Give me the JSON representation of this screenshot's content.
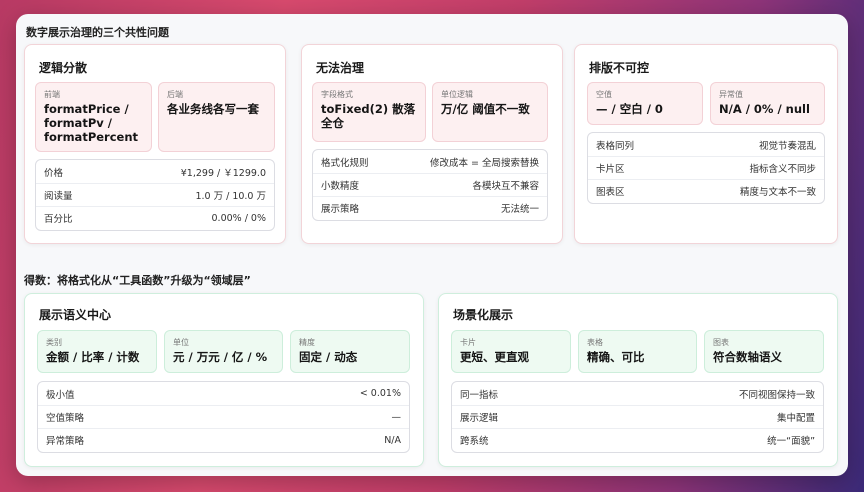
{
  "header": {
    "title": "数字展示治理的三个共性问题"
  },
  "problems": [
    {
      "title": "逻辑分散",
      "chips": [
        {
          "label": "前端",
          "value": "formatPrice / formatPv / formatPercent"
        },
        {
          "label": "后端",
          "value": "各业务线各写一套"
        }
      ],
      "rows": [
        {
          "k": "价格",
          "v": "¥1,299 / ￥1299.0"
        },
        {
          "k": "阅读量",
          "v": "1.0 万 / 10.0 万"
        },
        {
          "k": "百分比",
          "v": "0.00% / 0%"
        }
      ]
    },
    {
      "title": "无法治理",
      "chips": [
        {
          "label": "字段格式",
          "value": "toFixed(2) 散落全仓"
        },
        {
          "label": "单位逻辑",
          "value": "万/亿 阈值不一致"
        }
      ],
      "rows": [
        {
          "k": "格式化规则",
          "v": "修改成本 = 全局搜索替换"
        },
        {
          "k": "小数精度",
          "v": "各模块互不兼容"
        },
        {
          "k": "展示策略",
          "v": "无法统一"
        }
      ]
    },
    {
      "title": "排版不可控",
      "chips": [
        {
          "label": "空值",
          "value": "— / 空白 / 0"
        },
        {
          "label": "异常值",
          "value": "N/A / 0% / null"
        }
      ],
      "rows": [
        {
          "k": "表格同列",
          "v": "视觉节奏混乱"
        },
        {
          "k": "卡片区",
          "v": "指标含义不同步"
        },
        {
          "k": "图表区",
          "v": "精度与文本不一致"
        }
      ]
    }
  ],
  "section2": {
    "title": "得数：将格式化从“工具函数”升级为“领域层”"
  },
  "solutions": [
    {
      "title": "展示语义中心",
      "chips": [
        {
          "label": "类别",
          "value": "金额 / 比率 / 计数"
        },
        {
          "label": "单位",
          "value": "元 / 万元 / 亿 / %"
        },
        {
          "label": "精度",
          "value": "固定 / 动态"
        }
      ],
      "rows": [
        {
          "k": "极小值",
          "v": "< 0.01%"
        },
        {
          "k": "空值策略",
          "v": "—"
        },
        {
          "k": "异常策略",
          "v": "N/A"
        }
      ]
    },
    {
      "title": "场景化展示",
      "chips": [
        {
          "label": "卡片",
          "value": "更短、更直观"
        },
        {
          "label": "表格",
          "value": "精确、可比"
        },
        {
          "label": "图表",
          "value": "符合数轴语义"
        }
      ],
      "rows": [
        {
          "k": "同一指标",
          "v": "不同视图保持一致"
        },
        {
          "k": "展示逻辑",
          "v": "集中配置"
        },
        {
          "k": "跨系统",
          "v": "统一“面貌”"
        }
      ]
    }
  ]
}
